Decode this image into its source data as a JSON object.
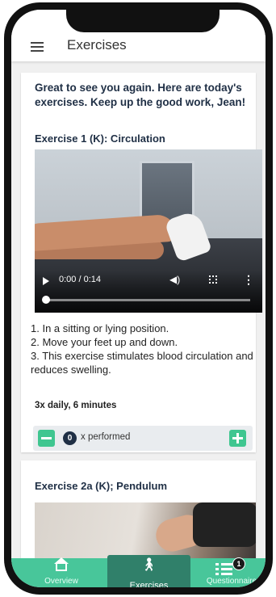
{
  "header": {
    "title": "Exercises"
  },
  "greeting": "Great to see you again. Here are today's exercises. Keep up the good work, Jean!",
  "exercise1": {
    "title": "Exercise 1 (K): Circulation",
    "video": {
      "time": "0:00 / 0:14",
      "progress": 0.0
    },
    "steps": [
      "1. In a sitting or lying position.",
      "2. Move your feet up and down.",
      "3. This exercise stimulates blood circulation and reduces swelling."
    ],
    "frequency": "3x daily, 6 minutes",
    "counter": {
      "count": "0",
      "label": "x performed"
    }
  },
  "exercise2": {
    "title": "Exercise 2a (K); Pendulum"
  },
  "bottom_nav": {
    "items": [
      {
        "label": "Overview",
        "icon": "home-icon"
      },
      {
        "label": "Exercises",
        "icon": "walking-icon",
        "active": true
      },
      {
        "label": "Questionnaire",
        "icon": "list-icon",
        "badge": "1"
      }
    ]
  },
  "colors": {
    "accent": "#48c69a",
    "active_tab": "#30806a",
    "heading": "#1f2f45"
  }
}
